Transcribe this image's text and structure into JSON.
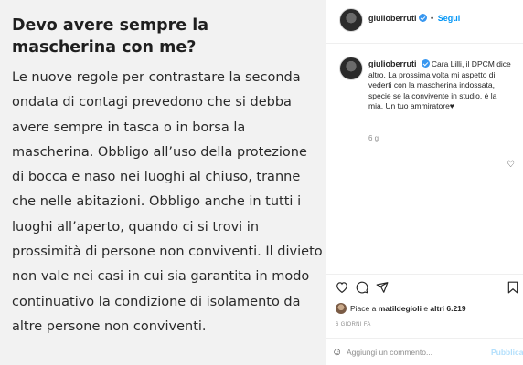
{
  "image_text": {
    "title": "Devo avere sempre la mascherina con me?",
    "body": "Le nuove regole per contrastare la seconda ondata di contagi prevedono che si debba avere sempre in tasca o in borsa la mascherina. Obbligo all’uso della protezione di bocca e naso nei luoghi al chiuso, tranne che nelle abitazioni. Obbligo anche in tutti i luoghi all’aperto, quando ci si trovi in prossimità di persone non conviventi. Il divieto non vale nei casi in cui sia garantita in modo continuativo la condizione di isolamento da altre persone non conviventi."
  },
  "header": {
    "username": "giulioberruti",
    "separator": "•",
    "follow_label": "Segui"
  },
  "caption": {
    "username": "giulioberruti",
    "text": "Cara Lilli, il DPCM dice altro. La prossima volta mi aspetto di vederti con la mascherina indossata, specie se la convivente in studio, è la mia. Un tuo ammiratore♥",
    "time_ago": "6 g"
  },
  "likes": {
    "prefix": "Piace a ",
    "user": "matildegioli",
    "middle": " e ",
    "others": "altri 6.219"
  },
  "date": "6 GIORNI FA",
  "comment_box": {
    "placeholder": "Aggiungi un commento...",
    "publish_label": "Pubblica"
  },
  "icons": {
    "like": "heart-icon",
    "comment": "comment-icon",
    "share": "share-icon",
    "save": "bookmark-icon",
    "emoji": "emoji-icon"
  },
  "colors": {
    "accent": "#0095f6",
    "verified": "#3897f0",
    "muted": "#8e8e8e",
    "publish_disabled": "#b2dffc"
  }
}
